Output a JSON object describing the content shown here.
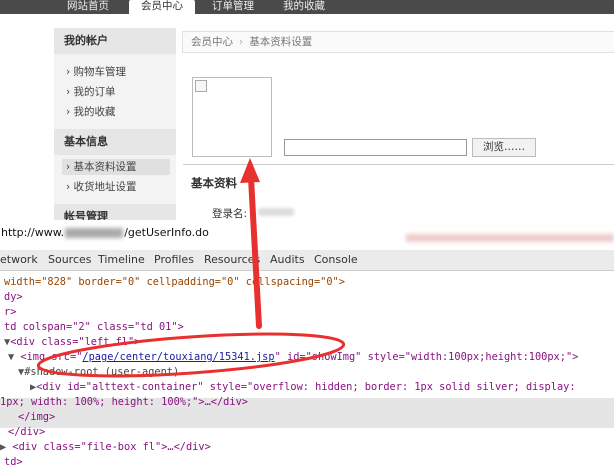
{
  "topnav": {
    "items": [
      "网站首页",
      "会员中心",
      "订单管理",
      "我的收藏"
    ]
  },
  "sidebar": {
    "account_heading": "我的帐户",
    "account_items": [
      "购物车管理",
      "我的订单",
      "我的收藏"
    ],
    "basic_heading": "基本信息",
    "basic_items": [
      "基本资料设置",
      "收货地址设置"
    ],
    "account_mgmt_heading": "帐号管理"
  },
  "breadcrumb": {
    "root": "会员中心",
    "separator": "›",
    "current": "基本资料设置"
  },
  "upload": {
    "browse_label": "浏览……"
  },
  "profile": {
    "section_title": "基本资料",
    "login_label": "登录名:"
  },
  "devtools": {
    "url_prefix": "http://www.",
    "url_suffix": "/getUserInfo.do",
    "tabs": [
      "etwork",
      "Sources",
      "Timeline",
      "Profiles",
      "Resources",
      "Audits",
      "Console"
    ],
    "code": {
      "l1_attrs": "width=\"828\" border=\"0\" cellpadding=\"0\" cellspacing=\"0\">",
      "l2": "dy>",
      "l3": "r>",
      "l4_tag": "td colspan=\"2\" class=\"td 01\">",
      "l5": "<div class=\"left fl\">",
      "l6_pre": "<img src=\"",
      "l6_src": "/page/center/touxiang/15341.jsp",
      "l6_post": "\" id=\"showImg\" style=\"width:100px;height:100px;\">",
      "l7": "#shadow-root (user-agent)",
      "l8": "<div id=\"alttext-container\" style=\"overflow: hidden; border: 1px solid silver; display:",
      "l9": "1px; width: 100%; height: 100%;\">…</div>",
      "l10": "</img>",
      "l11": "</div>",
      "l12": "<div class=\"file-box fl\">…</div>",
      "l13": "td>"
    }
  },
  "colors": {
    "annotation": "#e8302f",
    "nav_bg": "#4a4a4a"
  }
}
